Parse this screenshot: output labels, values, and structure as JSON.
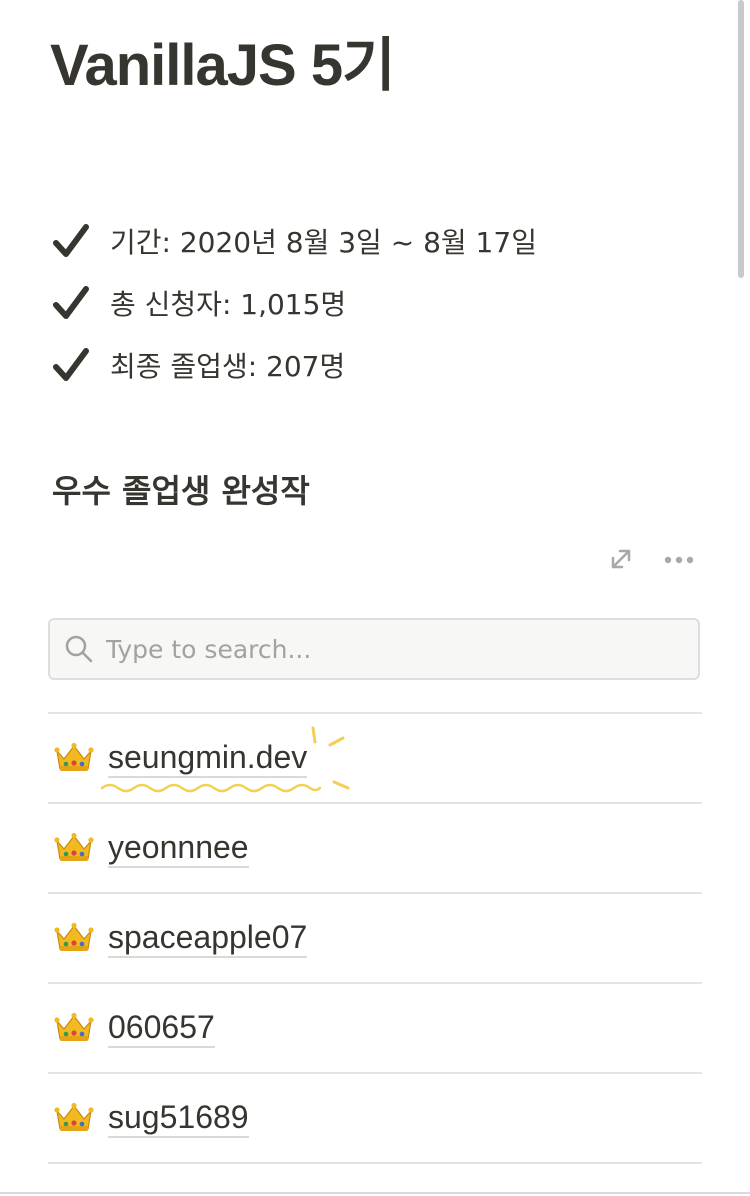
{
  "page": {
    "title": "VanillaJS 5기"
  },
  "info": {
    "items": [
      {
        "icon": "check-mark-icon",
        "text": "기간: 2020년 8월 3일 ~ 8월 17일"
      },
      {
        "icon": "check-mark-icon",
        "text": "총 신청자: 1,015명"
      },
      {
        "icon": "check-mark-icon",
        "text": "최종 졸업생: 207명"
      }
    ]
  },
  "section": {
    "title": "우수 졸업생 완성작"
  },
  "database": {
    "actions": [
      "expand-icon",
      "more-icon"
    ],
    "search": {
      "placeholder": "Type to search...",
      "value": ""
    },
    "rows": [
      {
        "icon": "crown-icon",
        "name": "seungmin.dev"
      },
      {
        "icon": "crown-icon",
        "name": "yeonnnee"
      },
      {
        "icon": "crown-icon",
        "name": "spaceapple07"
      },
      {
        "icon": "crown-icon",
        "name": "060657"
      },
      {
        "icon": "crown-icon",
        "name": "sug51689"
      }
    ]
  },
  "colors": {
    "text": "#37352f",
    "muted": "#a3a29f",
    "border": "#e4e4e2",
    "search_bg": "#f7f7f5",
    "highlight_annotation": "#f2cf55"
  }
}
